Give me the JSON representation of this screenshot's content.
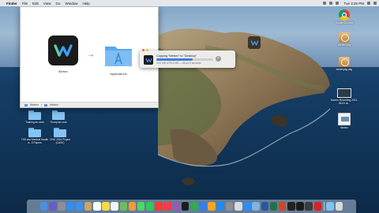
{
  "menubar": {
    "app": "Finder",
    "menus": [
      "File",
      "Edit",
      "View",
      "Go",
      "Window",
      "Help"
    ],
    "clock": "Tue 3:25 PM"
  },
  "finder": {
    "dmg_label": "Webex",
    "apps_label": "Applications",
    "drag_note": "Drag to Applications",
    "path_items": [
      "Webex",
      "Webex"
    ]
  },
  "copy_dialog": {
    "title": "Copying “Webex” to “Desktop”",
    "status": "34.0 MB of 99.6 MB — About 5 seconds",
    "progress": 0.64
  },
  "desktop_left": [
    {
      "label": "Training for work"
    },
    {
      "label": "Trump tax cuts"
    },
    {
      "label": "TSS and Medical Health a...0 Papers"
    },
    {
      "label": "OHO 2024 Project (CASE)"
    }
  ],
  "desktop_right": [
    {
      "icon": "chrome-icon",
      "label": "Google Chrome"
    },
    {
      "icon": "package-icon",
      "label": "Webex.pkg"
    },
    {
      "icon": "package-icon",
      "label": "webexpkg.pkg"
    },
    {
      "icon": "screenshot-icon",
      "label": "Screen Recording 2021-08-09 at..."
    },
    {
      "icon": "video-icon",
      "label": "Webex"
    }
  ],
  "dock": [
    {
      "name": "finder",
      "color": "#4a90e2"
    },
    {
      "name": "siri",
      "color": "#6a5acd"
    },
    {
      "name": "launchpad",
      "color": "#8e8e93"
    },
    {
      "name": "safari",
      "color": "#2f8ef0"
    },
    {
      "name": "mail",
      "color": "#3d8ef7"
    },
    {
      "name": "contacts",
      "color": "#c9a46b"
    },
    {
      "name": "calendar",
      "color": "#ffffff"
    },
    {
      "name": "notes",
      "color": "#f5d94a"
    },
    {
      "name": "reminders",
      "color": "#f2f2f2"
    },
    {
      "name": "maps",
      "color": "#6bbf59"
    },
    {
      "name": "photos",
      "color": "#f29b38"
    },
    {
      "name": "messages",
      "color": "#4cd964"
    },
    {
      "name": "facetime",
      "color": "#34c759"
    },
    {
      "name": "news",
      "color": "#ff3b30"
    },
    {
      "name": "music",
      "color": "#fc3c44"
    },
    {
      "name": "podcasts",
      "color": "#9b59b6"
    },
    {
      "name": "tv",
      "color": "#1c1c1e"
    },
    {
      "name": "numbers",
      "color": "#34a853"
    },
    {
      "name": "keynote",
      "color": "#2f80ed"
    },
    {
      "name": "pages",
      "color": "#f5a623"
    },
    {
      "name": "app-store",
      "color": "#1d8cf8"
    },
    {
      "name": "system-preferences",
      "color": "#8e8e93"
    },
    {
      "name": "chrome",
      "color": "#dbdbdb"
    },
    {
      "name": "zoom",
      "color": "#2d8cff"
    },
    {
      "name": "preview",
      "color": "#7fb3e0"
    },
    {
      "name": "word",
      "color": "#2b579a"
    },
    {
      "name": "excel",
      "color": "#217346"
    },
    {
      "name": "powerpoint",
      "color": "#d24726"
    },
    {
      "name": "terminal",
      "color": "#222222"
    },
    {
      "name": "webex",
      "color": "#1b1b1b"
    },
    {
      "name": "quicktime",
      "color": "#3b3b3b"
    },
    {
      "name": "acrobat",
      "color": "#e02020"
    },
    {
      "name": "folder-downloads",
      "color": "#7fc0f5"
    },
    {
      "name": "trash",
      "color": "#d9d9d9"
    }
  ]
}
